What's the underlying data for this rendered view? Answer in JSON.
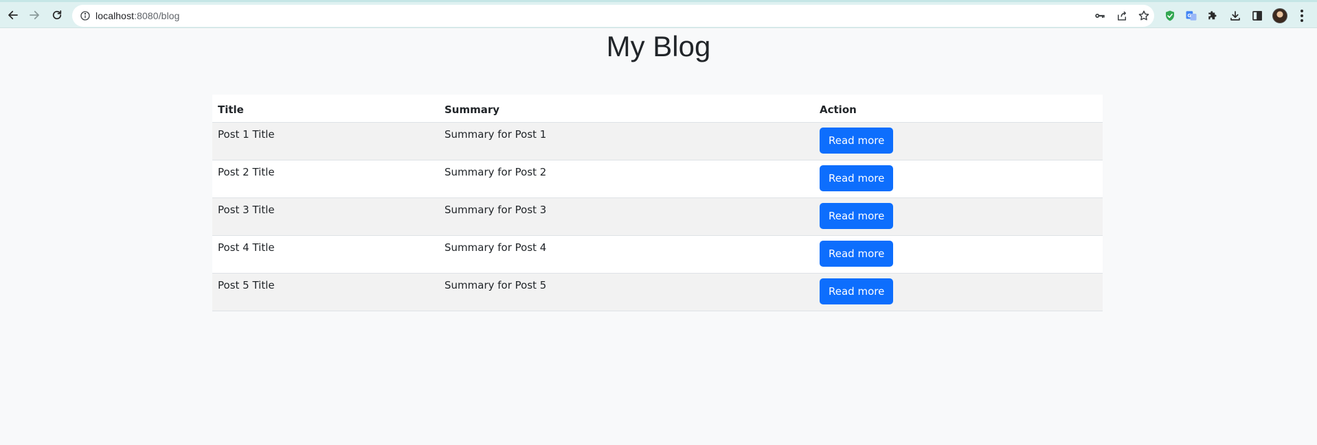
{
  "browser": {
    "url_host": "localhost",
    "url_path": ":8080/blog"
  },
  "page": {
    "title": "My Blog"
  },
  "table": {
    "headers": {
      "title": "Title",
      "summary": "Summary",
      "action": "Action"
    },
    "rows": [
      {
        "title": "Post 1 Title",
        "summary": "Summary for Post 1",
        "action": "Read more"
      },
      {
        "title": "Post 2 Title",
        "summary": "Summary for Post 2",
        "action": "Read more"
      },
      {
        "title": "Post 3 Title",
        "summary": "Summary for Post 3",
        "action": "Read more"
      },
      {
        "title": "Post 4 Title",
        "summary": "Summary for Post 4",
        "action": "Read more"
      },
      {
        "title": "Post 5 Title",
        "summary": "Summary for Post 5",
        "action": "Read more"
      }
    ]
  },
  "colors": {
    "button": "#0d6efd",
    "page_background": "#f8f9fa",
    "striped_row": "#f2f2f2",
    "browser_toolbar": "#dff1f1"
  },
  "icons": {
    "back": "arrow-left-icon",
    "forward": "arrow-right-icon",
    "reload": "reload-icon",
    "site_info": "info-icon",
    "password": "key-icon",
    "share": "share-icon",
    "bookmark": "star-icon",
    "extension_1": "shield-check-icon",
    "extension_2": "translate-icon",
    "extensions": "puzzle-icon",
    "downloads": "download-icon",
    "side_panel": "side-panel-icon",
    "profile": "avatar",
    "menu": "kebab-menu-icon"
  }
}
